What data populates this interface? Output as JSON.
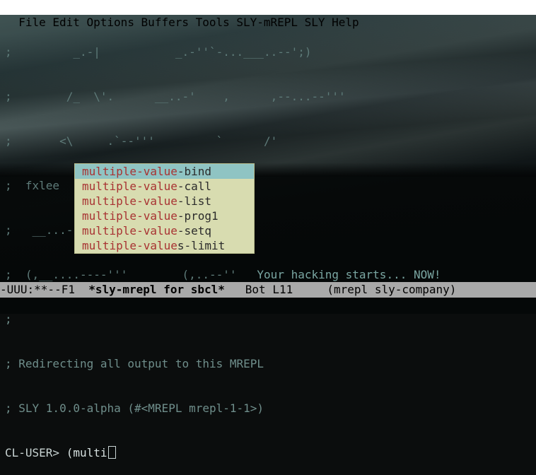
{
  "menu": [
    "File",
    "Edit",
    "Options",
    "Buffers",
    "Tools",
    "SLY-mREPL",
    "SLY",
    "Help"
  ],
  "banner": [
    ";         _.-|           _.-''`-...___..--';)",
    ";        /_  \\'.      __..-'    ,      ,--...--'''",
    ";       <\\     .`--'''         `      /'",
    ";  fxlee  `-';'               ;   ; ;",
    ";   __...--''      ___...--_..'  .;.'",
    ";  (,__....----'''        (,..--''"
  ],
  "hack_text": "   Your hacking starts... NOW!",
  "lines": [
    ";",
    "; Redirecting all output to this MREPL",
    "; SLY 1.0.0-alpha (#<MREPL mrepl-1-1>)"
  ],
  "prompt": "CL-USER>",
  "input": " (multi",
  "completions": [
    {
      "match": "multiple-value",
      "rest": "-bind",
      "selected": true
    },
    {
      "match": "multiple-value",
      "rest": "-call",
      "selected": false
    },
    {
      "match": "multiple-value",
      "rest": "-list",
      "selected": false
    },
    {
      "match": "multiple-value",
      "rest": "-prog1",
      "selected": false
    },
    {
      "match": "multiple-value",
      "rest": "-setq",
      "selected": false
    },
    {
      "match": "multiple-value",
      "rest": "s-limit",
      "selected": false
    }
  ],
  "modeline": {
    "status": "-UUU:**--F1  ",
    "buffer_name": "*sly-mrepl for sbcl*",
    "position": "   Bot L11     ",
    "modes": "(mrepl sly-company)"
  },
  "colors": {
    "menubar_bg": "#ffffff",
    "popup_bg": "#d8dcb0",
    "popup_selected": "#8fc4c3",
    "match_text": "#a83232",
    "modeline_bg": "#a9a9a9"
  }
}
